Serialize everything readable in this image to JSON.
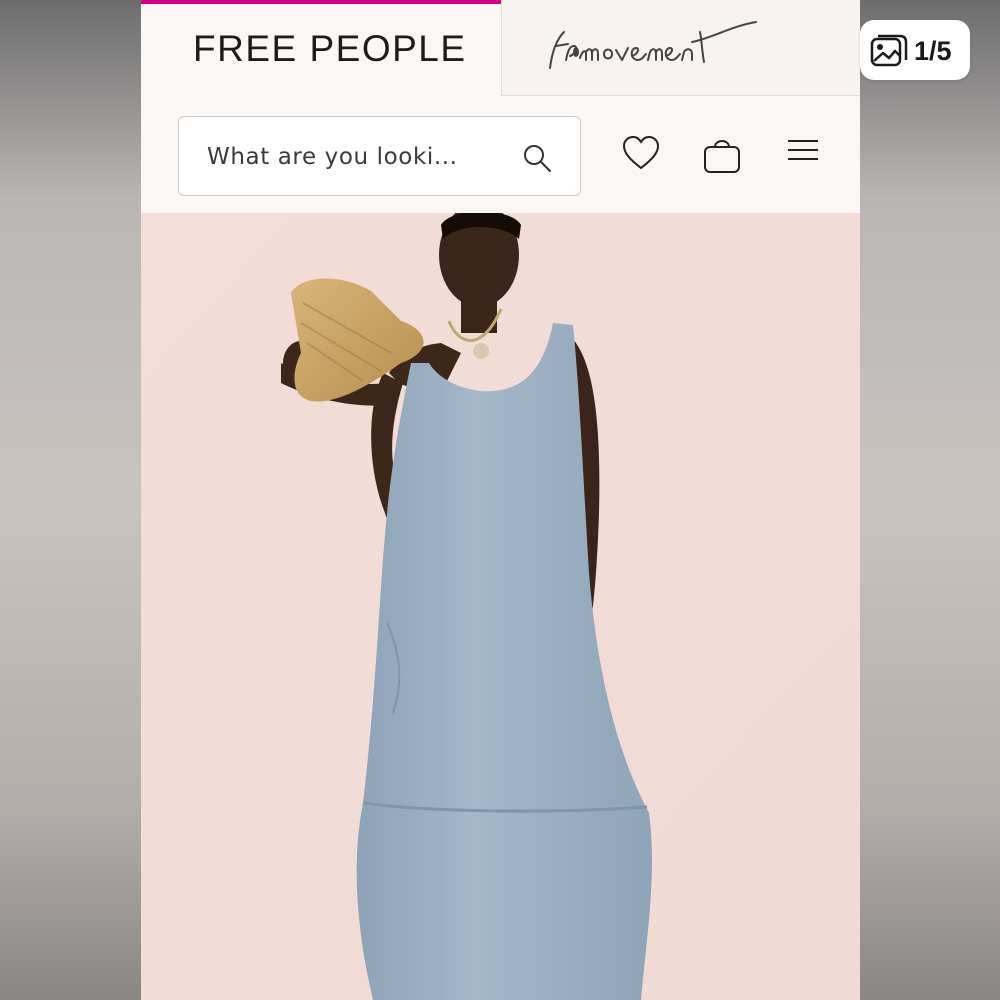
{
  "header": {
    "brand": "FREE PEOPLE",
    "movement_logo": "fp movement",
    "search_placeholder": "What are you looki...",
    "icons": [
      "search-icon",
      "heart-icon",
      "bag-icon",
      "menu-icon"
    ]
  },
  "gallery": {
    "counter": "1/5",
    "counter_icon": "image-gallery-icon",
    "photo_alt": "Model in blue-grey sleeveless midi dress holding a straw hat"
  },
  "colors": {
    "brand_accent": "#d6007e",
    "dress_blue": "#9db0c4",
    "backdrop": "#f3dfd9"
  }
}
